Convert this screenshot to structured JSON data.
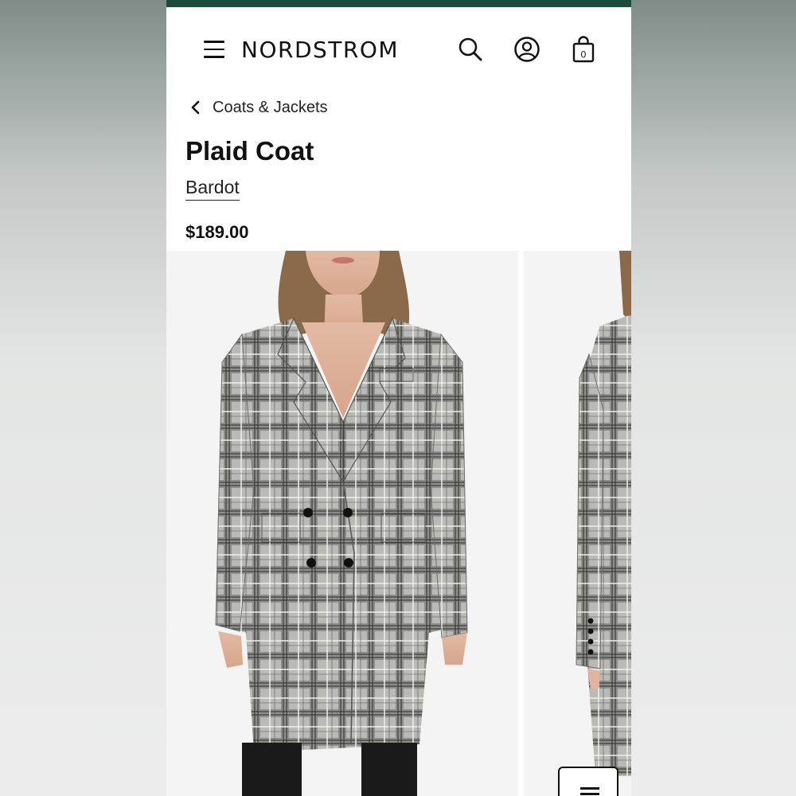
{
  "header": {
    "logo": "NORDSTROM",
    "icons": [
      "menu-icon",
      "search-icon",
      "account-icon",
      "shopping-bag-icon"
    ],
    "bag_count": "0",
    "accent_color": "#1e4a3b"
  },
  "breadcrumb": {
    "label": "Coats & Jackets"
  },
  "product": {
    "title": "Plaid Coat",
    "brand": "Bardot",
    "price": "$189.00"
  }
}
